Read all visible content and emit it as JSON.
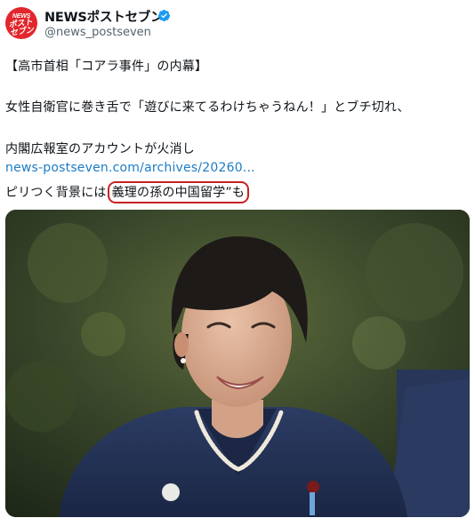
{
  "author": {
    "avatar_text_top": "NEWS",
    "avatar_text_bottom": "ポスト\nセブン",
    "display_name": "NEWSポストセブン",
    "handle": "@news_postseven",
    "verified": true,
    "avatar_color": "#e3262c",
    "verified_color": "#1d9bf0"
  },
  "tweet": {
    "line1": "【高市首相「コアラ事件」の内幕】",
    "line2": "女性自衛官に巻き舌で「遊びに来てるわけちゃうねん！」とブチ切れ、",
    "line3": "内閣広報室のアカウントが火消し",
    "link": "news-postseven.com/archives/20260...",
    "line5_prefix": "ピリつく背景には",
    "line5_highlight": "義理の孫の中国留学",
    "line5_suffix": "”も",
    "link_color": "#1d7cc6",
    "highlight_color": "#c82121"
  },
  "media": {
    "icon": "photo-of-smiling-woman"
  }
}
